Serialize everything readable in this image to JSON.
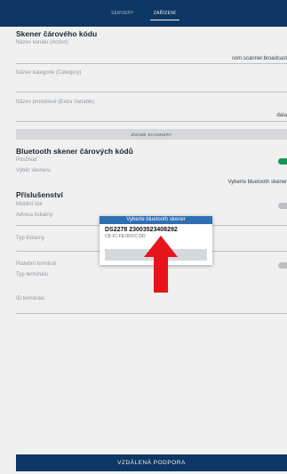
{
  "tabs": [
    {
      "label": "SERVERY",
      "active": false
    },
    {
      "label": "ZAŘÍZENÍ",
      "active": true
    }
  ],
  "barcode_section": {
    "title": "Skener čárového kódu",
    "action_label": "Název kanálu (Action)",
    "action_value": "com.scanner.broadcast",
    "category_label": "Název kategorie (Category)",
    "category_value": "",
    "extra_label": "Název proměnné (Extra Variable)",
    "extra_value": "data"
  },
  "known_scanners_label": "ZNÁMÉ SCANNERY",
  "bluetooth_section": {
    "title": "Bluetooth skener čárových kódů",
    "use_label": "Používat",
    "use_enabled": true,
    "scanner_select_label": "Výběr skeneru",
    "scanner_select_value": "Vyberte bluetooth skener"
  },
  "accessories_section": {
    "title": "Příslušenství",
    "mobile_print_label": "Mobilní tisk",
    "mobile_print_enabled": false,
    "printer_address_label": "Adresa tiskárny",
    "printer_type_label": "Typ tiskárny",
    "payment_terminal_label": "Platební terminál",
    "payment_terminal_enabled": false,
    "terminal_type_label": "Typ terminálu",
    "terminal_id_label": "ID terminálu"
  },
  "dialog": {
    "title": "Vyberte bluetooth skener",
    "device_name": "DS2278 23003523408292",
    "device_mac": "C8:1C:FE:00:FC:DD"
  },
  "footer_button_label": "VZDÁLENÁ PODPORA",
  "colors": {
    "header": "#0e3b6b",
    "dialog_header": "#2f6fb4",
    "toggle_on": "#17a05d",
    "arrow": "#e8141c"
  },
  "icons": {
    "annotation": "arrow-up-icon"
  }
}
